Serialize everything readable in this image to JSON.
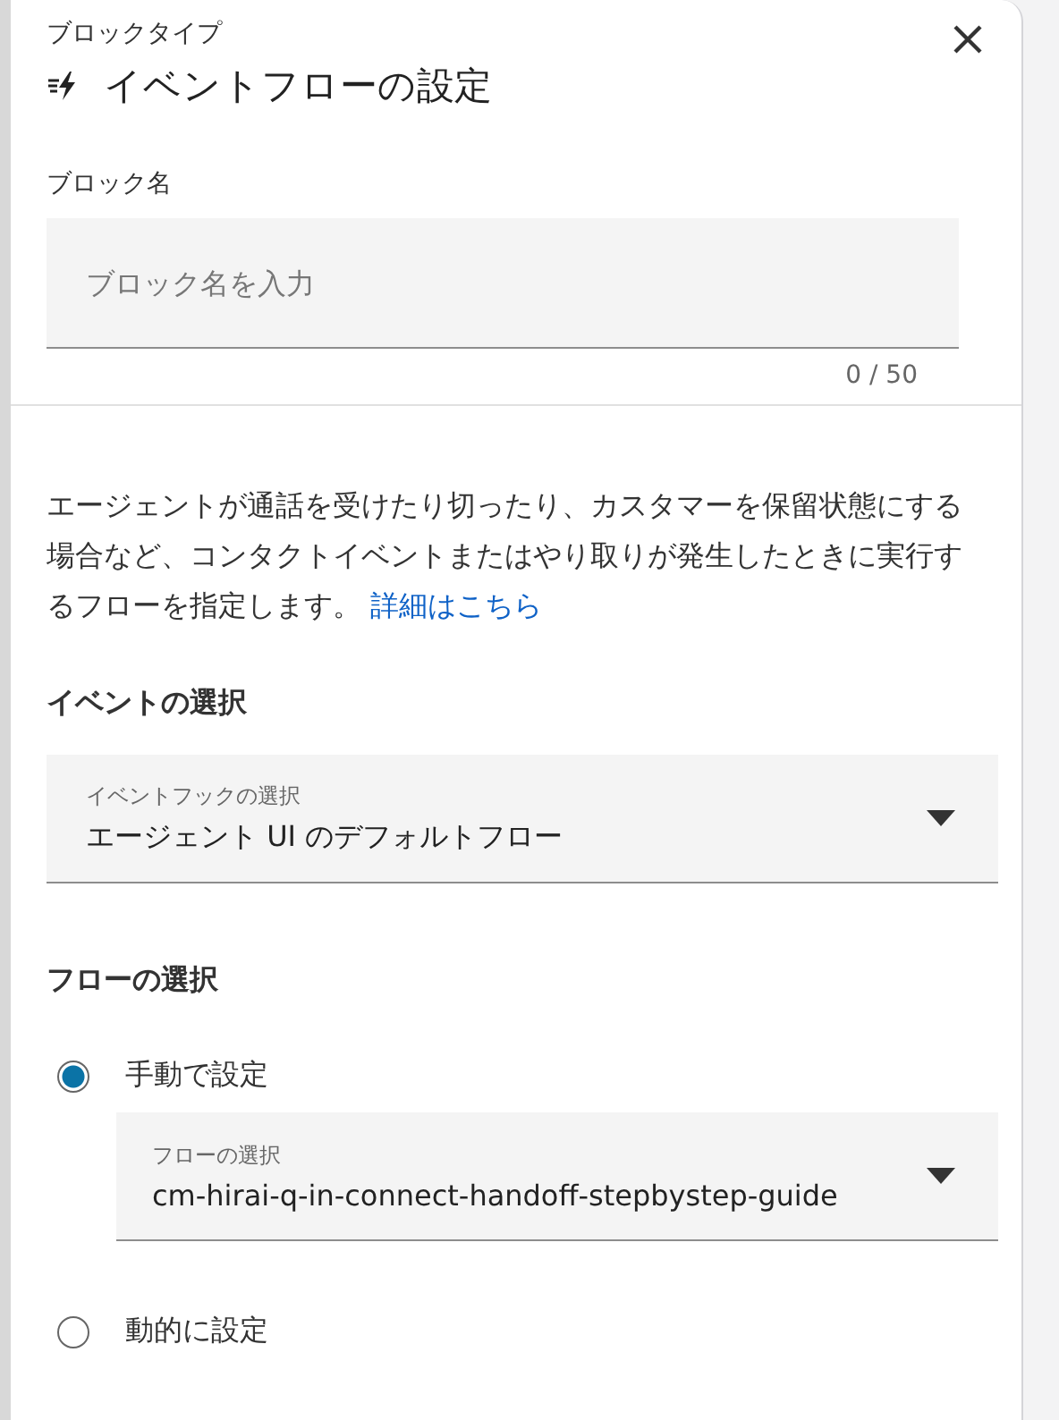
{
  "header": {
    "subtitle": "ブロックタイプ",
    "title": "イベントフローの設定"
  },
  "block_name": {
    "label": "ブロック名",
    "placeholder": "ブロック名を入力",
    "counter": "0 / 50"
  },
  "description": {
    "text": "エージェントが通話を受けたり切ったり、カスタマーを保留状態にする場合など、コンタクトイベントまたはやり取りが発生したときに実行するフローを指定します。",
    "link": "詳細はこちら"
  },
  "event_section": {
    "heading": "イベントの選択",
    "dropdown": {
      "label": "イベントフックの選択",
      "value": "エージェント UI のデフォルトフロー"
    }
  },
  "flow_section": {
    "heading": "フローの選択",
    "options": [
      {
        "label": "手動で設定",
        "selected": true,
        "dropdown": {
          "label": "フローの選択",
          "value": "cm-hirai-q-in-connect-handoff-stepbystep-guide"
        }
      },
      {
        "label": "動的に設定",
        "selected": false
      }
    ]
  }
}
